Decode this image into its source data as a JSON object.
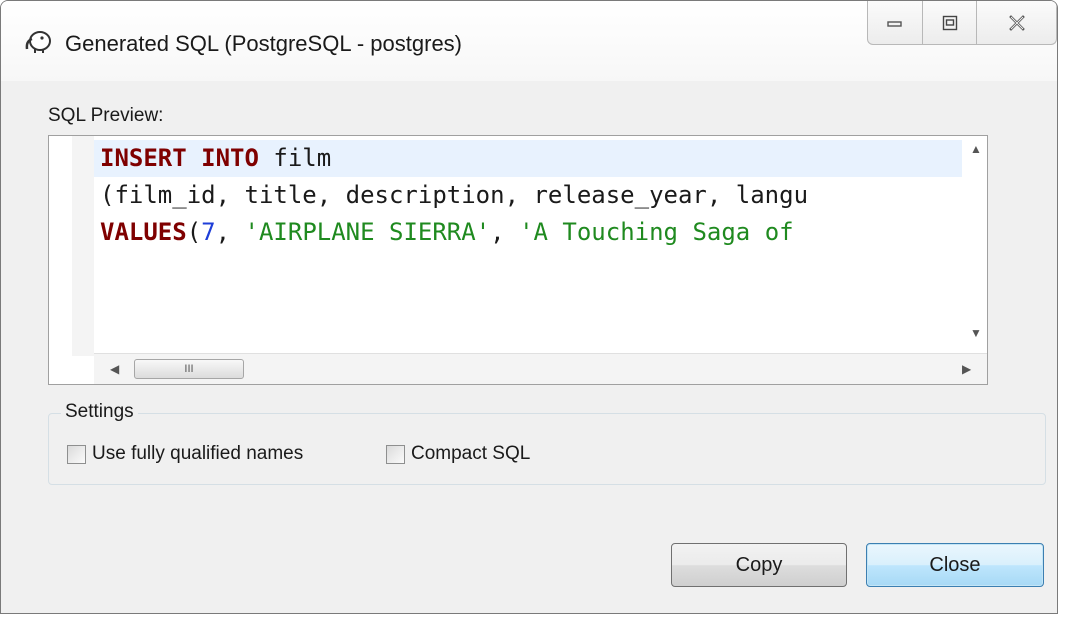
{
  "window": {
    "title": "Generated SQL (PostgreSQL - postgres)",
    "icon": "elephant-icon",
    "controls": {
      "minimize_icon": "minimize-icon",
      "maximize_icon": "maximize-icon",
      "close_icon": "close-icon"
    }
  },
  "preview": {
    "label": "SQL Preview:",
    "lines": [
      [
        {
          "t": "INSERT",
          "c": "kw"
        },
        {
          "t": " ",
          "c": "plain"
        },
        {
          "t": "INTO",
          "c": "kw"
        },
        {
          "t": " film",
          "c": "plain"
        }
      ],
      [
        {
          "t": "(film_id, title, description, release_year, langu",
          "c": "plain"
        }
      ],
      [
        {
          "t": "VALUES",
          "c": "kw"
        },
        {
          "t": "(",
          "c": "plain"
        },
        {
          "t": "7",
          "c": "num"
        },
        {
          "t": ", ",
          "c": "plain"
        },
        {
          "t": "'AIRPLANE SIERRA'",
          "c": "str"
        },
        {
          "t": ", ",
          "c": "plain"
        },
        {
          "t": "'A Touching Saga of",
          "c": "str"
        }
      ]
    ],
    "hscroll_thumb_glyph": "III"
  },
  "settings": {
    "legend": "Settings",
    "fully_qualified_label": "Use fully qualified names",
    "fully_qualified_checked": false,
    "compact_sql_label": "Compact SQL",
    "compact_sql_checked": false
  },
  "buttons": {
    "copy_label": "Copy",
    "close_label": "Close"
  },
  "colors": {
    "keyword": "#7f0000",
    "number": "#1e3ed8",
    "string": "#1f8a1f",
    "current_line": "#e8f2fe"
  }
}
